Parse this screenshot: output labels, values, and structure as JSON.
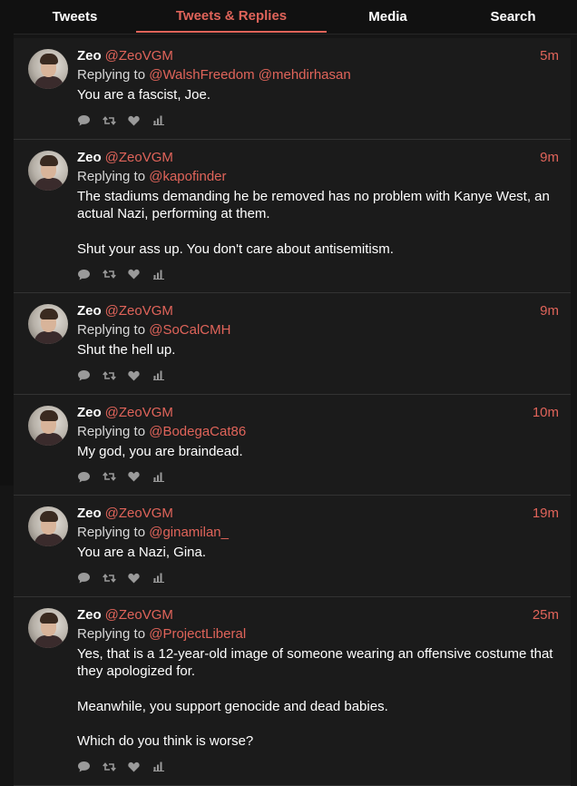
{
  "tabs": [
    "Tweets",
    "Tweets & Replies",
    "Media",
    "Search"
  ],
  "active_tab": "Tweets & Replies",
  "accent_color": "#e0645a",
  "tweets": [
    {
      "name": "Zeo",
      "handle": "@ZeoVGM",
      "time": "5m",
      "replying_label": "Replying to",
      "replying_to": [
        "@WalshFreedom",
        "@mehdirhasan"
      ],
      "paragraphs": [
        "You are a fascist, Joe."
      ]
    },
    {
      "name": "Zeo",
      "handle": "@ZeoVGM",
      "time": "9m",
      "replying_label": "Replying to",
      "replying_to": [
        "@kapofinder"
      ],
      "paragraphs": [
        "The stadiums demanding he be removed has no problem with Kanye West, an actual Nazi, performing at them.",
        "Shut your ass up. You don't care about antisemitism."
      ]
    },
    {
      "name": "Zeo",
      "handle": "@ZeoVGM",
      "time": "9m",
      "replying_label": "Replying to",
      "replying_to": [
        "@SoCalCMH"
      ],
      "paragraphs": [
        "Shut the hell up."
      ]
    },
    {
      "name": "Zeo",
      "handle": "@ZeoVGM",
      "time": "10m",
      "replying_label": "Replying to",
      "replying_to": [
        "@BodegaCat86"
      ],
      "paragraphs": [
        "My god, you are braindead."
      ]
    },
    {
      "name": "Zeo",
      "handle": "@ZeoVGM",
      "time": "19m",
      "replying_label": "Replying to",
      "replying_to": [
        "@ginamilan_"
      ],
      "paragraphs": [
        "You are a Nazi, Gina."
      ]
    },
    {
      "name": "Zeo",
      "handle": "@ZeoVGM",
      "time": "25m",
      "replying_label": "Replying to",
      "replying_to": [
        "@ProjectLiberal"
      ],
      "paragraphs": [
        "Yes, that is a 12-year-old image of someone wearing an offensive costume that they apologized for.",
        "Meanwhile, you support genocide and dead babies.",
        "Which do you think is worse?"
      ]
    }
  ],
  "action_icons": [
    "reply-icon",
    "retweet-icon",
    "like-icon",
    "stats-icon"
  ]
}
